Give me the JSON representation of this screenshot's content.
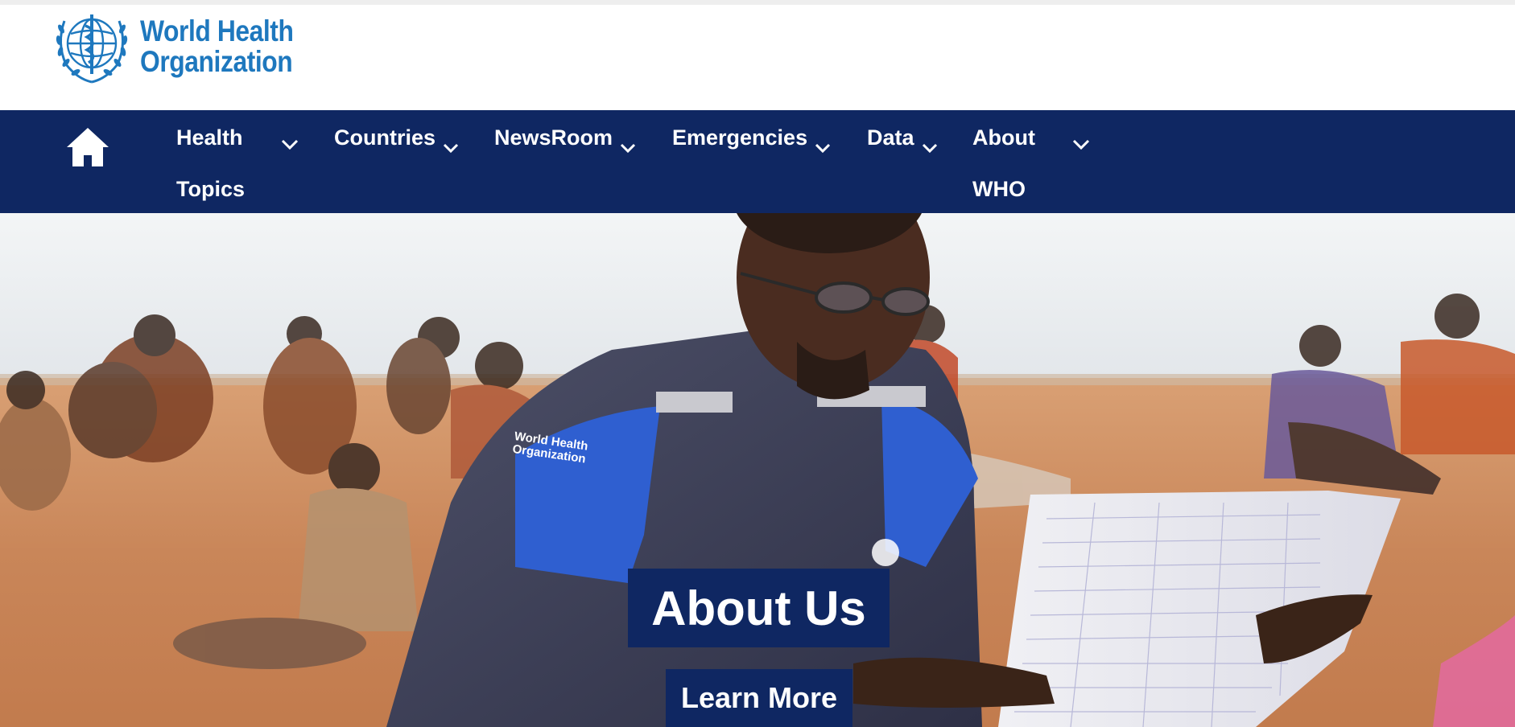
{
  "brand": {
    "name_line1": "World Health",
    "name_line2": "Organization",
    "color": "#1e78be"
  },
  "nav": {
    "background": "#0f2762",
    "home_icon": "home-icon",
    "items": [
      {
        "label": "Health",
        "label2": "Topics",
        "icon": "chevron-down-icon"
      },
      {
        "label": "Countries",
        "icon": "chevron-down-icon"
      },
      {
        "label": "NewsRoom",
        "icon": "chevron-down-icon"
      },
      {
        "label": "Emergencies",
        "icon": "chevron-down-icon"
      },
      {
        "label": "Data",
        "icon": "chevron-down-icon"
      },
      {
        "label": "About",
        "label2": "WHO",
        "icon": "chevron-down-icon"
      }
    ]
  },
  "hero": {
    "image": "who-field-worker-photo",
    "title": "About Us",
    "cta_label": "Learn More",
    "vest_badge": "World Health Organization"
  }
}
